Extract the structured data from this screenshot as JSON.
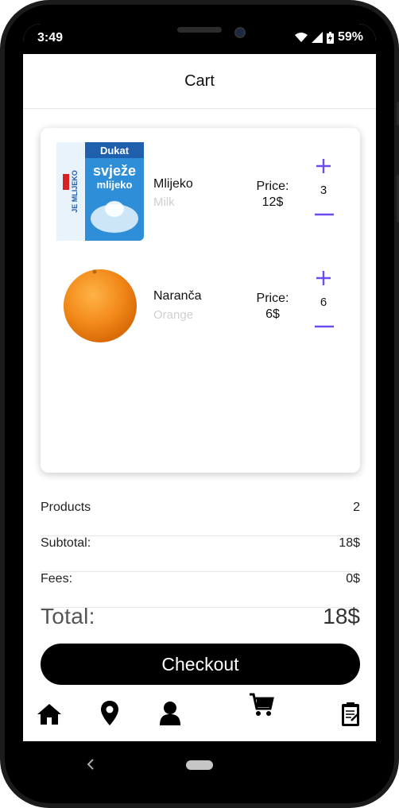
{
  "status_bar": {
    "time": "3:49",
    "battery": "59%"
  },
  "app_bar": {
    "title": "Cart"
  },
  "cart_items": [
    {
      "name": "Mlijeko",
      "subtitle": "Milk",
      "price_label": "Price:",
      "price": "12$",
      "quantity": "3",
      "image_text": [
        "Dukat",
        "svježe",
        "mlijeko",
        "JE MLIJEKO"
      ]
    },
    {
      "name": "Naranča",
      "subtitle": "Orange",
      "price_label": "Price:",
      "price": "6$",
      "quantity": "6"
    }
  ],
  "summary": {
    "products_label": "Products",
    "products_value": "2",
    "subtotal_label": "Subtotal:",
    "subtotal_value": "18$",
    "fees_label": "Fees:",
    "fees_value": "0$",
    "total_label": "Total:",
    "total_value": "18$"
  },
  "checkout_label": "Checkout",
  "nav": [
    "home-icon",
    "location-icon",
    "profile-icon",
    "cart-icon",
    "clipboard-icon"
  ],
  "colors": {
    "accent": "#6a4cf0",
    "button": "#000000",
    "subtitle": "#cfcfcf"
  }
}
